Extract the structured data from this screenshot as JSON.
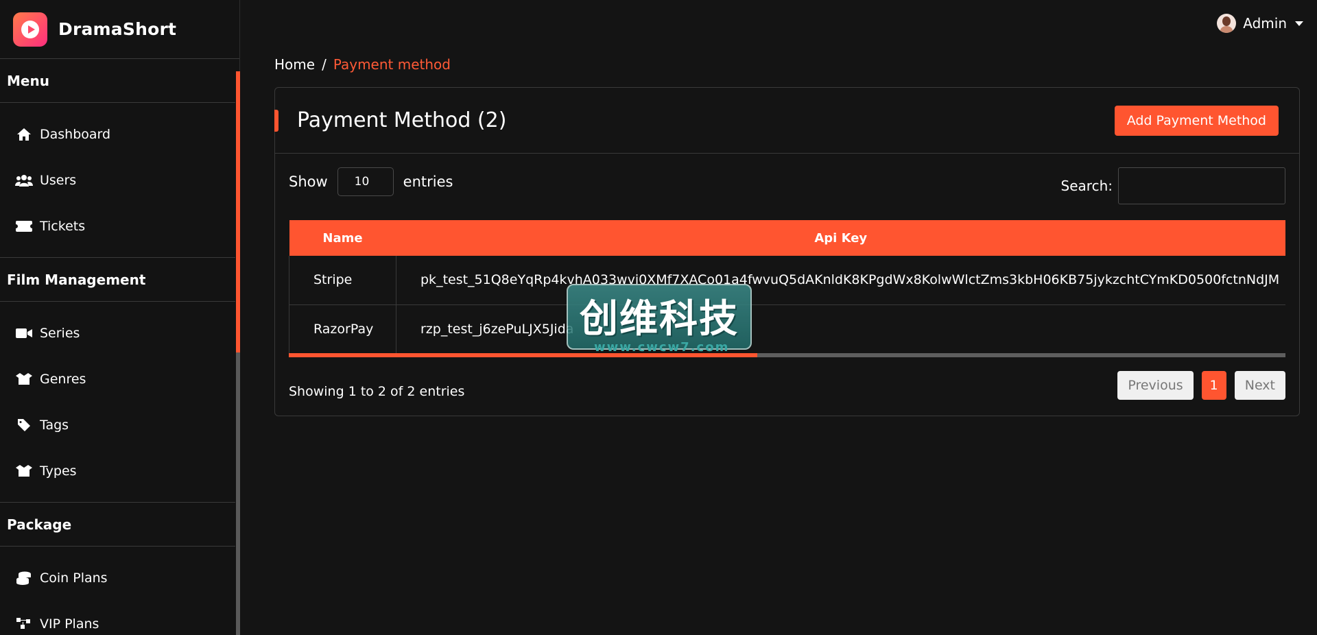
{
  "brand": {
    "name": "DramaShort"
  },
  "user": {
    "name": "Admin"
  },
  "sidebar": {
    "sections": [
      {
        "title": "Menu",
        "items": [
          {
            "label": "Dashboard",
            "icon": "home-icon"
          },
          {
            "label": "Users",
            "icon": "users-icon"
          },
          {
            "label": "Tickets",
            "icon": "ticket-icon"
          }
        ]
      },
      {
        "title": "Film Management",
        "items": [
          {
            "label": "Series",
            "icon": "video-icon"
          },
          {
            "label": "Genres",
            "icon": "box-icon"
          },
          {
            "label": "Tags",
            "icon": "tag-icon"
          },
          {
            "label": "Types",
            "icon": "box-icon"
          }
        ]
      },
      {
        "title": "Package",
        "items": [
          {
            "label": "Coin Plans",
            "icon": "coins-icon"
          },
          {
            "label": "VIP Plans",
            "icon": "vip-icon"
          }
        ]
      }
    ]
  },
  "breadcrumb": {
    "home": "Home",
    "separator": "/",
    "current": "Payment method"
  },
  "card": {
    "title": "Payment Method (2)",
    "add_button": "Add Payment Method"
  },
  "controls": {
    "show_label": "Show",
    "page_size": "10",
    "entries_label": "entries",
    "search_label": "Search:",
    "search_value": ""
  },
  "table": {
    "columns": [
      "Name",
      "Api Key"
    ],
    "rows": [
      {
        "name": "Stripe",
        "api_key": "pk_test_51Q8eYqRp4kvhA033wvi0XMf7XACo01a4fwvuQ5dAKnldK8KPgdWx8KolwWlctZms3kbH06KB75jykzchtCYmKD0500fctnNdJM"
      },
      {
        "name": "RazorPay",
        "api_key": "rzp_test_j6zePuLJX5Jida"
      }
    ]
  },
  "footer": {
    "info": "Showing 1 to 2 of 2 entries",
    "previous": "Previous",
    "current_page": "1",
    "next": "Next"
  },
  "watermark": {
    "text": "创维科技",
    "url": "www.cwcw7.com"
  },
  "colors": {
    "accent": "#ff5530",
    "background": "#141414"
  }
}
